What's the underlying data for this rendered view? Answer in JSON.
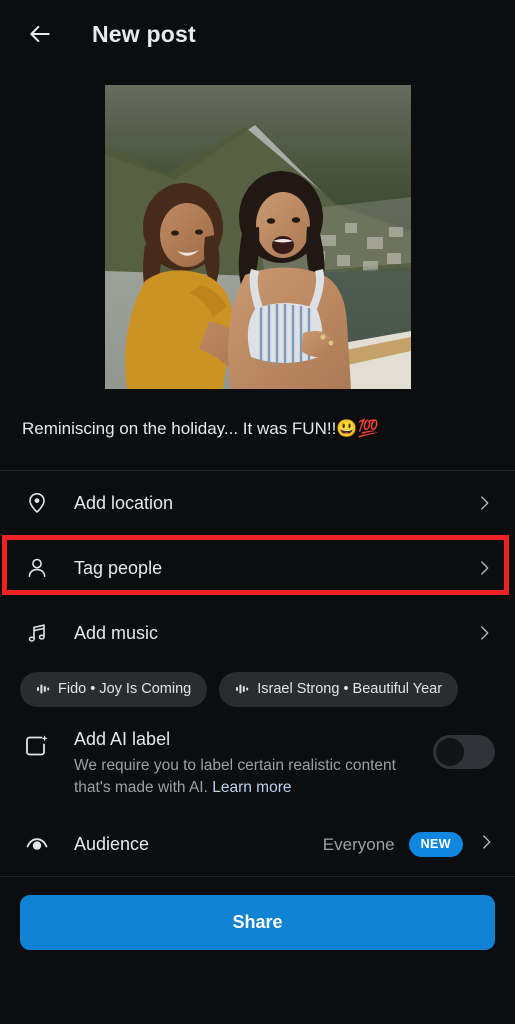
{
  "header": {
    "back_icon": "arrow-left-icon",
    "title": "New post"
  },
  "post": {
    "photo_alt": "Two women laughing on a boat with coastal mountains behind",
    "caption_text": "Reminiscing on the holiday... It was FUN!!",
    "caption_emoji_1": "😃",
    "caption_emoji_2": "💯"
  },
  "options": [
    {
      "label": "Add location",
      "icon": "location-pin-icon",
      "chevron": "chevron-right-icon"
    },
    {
      "label": "Tag people",
      "icon": "person-icon",
      "chevron": "chevron-right-icon"
    },
    {
      "label": "Add music",
      "icon": "music-note-icon",
      "chevron": "chevron-right-icon"
    }
  ],
  "music_suggestions": [
    {
      "label": "Fido • Joy Is Coming",
      "icon": "audio-wave-icon"
    },
    {
      "label": "Israel Strong • Beautiful Year",
      "icon": "audio-wave-icon"
    }
  ],
  "ai_label": {
    "icon": "ai-sparkle-square-icon",
    "title": "Add AI label",
    "description": "We require you to label certain realistic content that's made with AI. ",
    "link_text": "Learn more",
    "toggle_state": "off"
  },
  "audience": {
    "icon": "eye-icon",
    "label": "Audience",
    "value": "Everyone",
    "badge": "NEW",
    "chevron": "chevron-right-icon"
  },
  "share": {
    "label": "Share"
  },
  "colors": {
    "background": "#0b0d0f",
    "accent_blue": "#0f82d4",
    "badge_blue": "#0f87e0",
    "highlight_red": "#ee2222",
    "primary_text": "#e6e8ea",
    "secondary_text": "#9aa0a6",
    "chip_background": "#2a2d30",
    "link_text": "#b9d4ee"
  }
}
